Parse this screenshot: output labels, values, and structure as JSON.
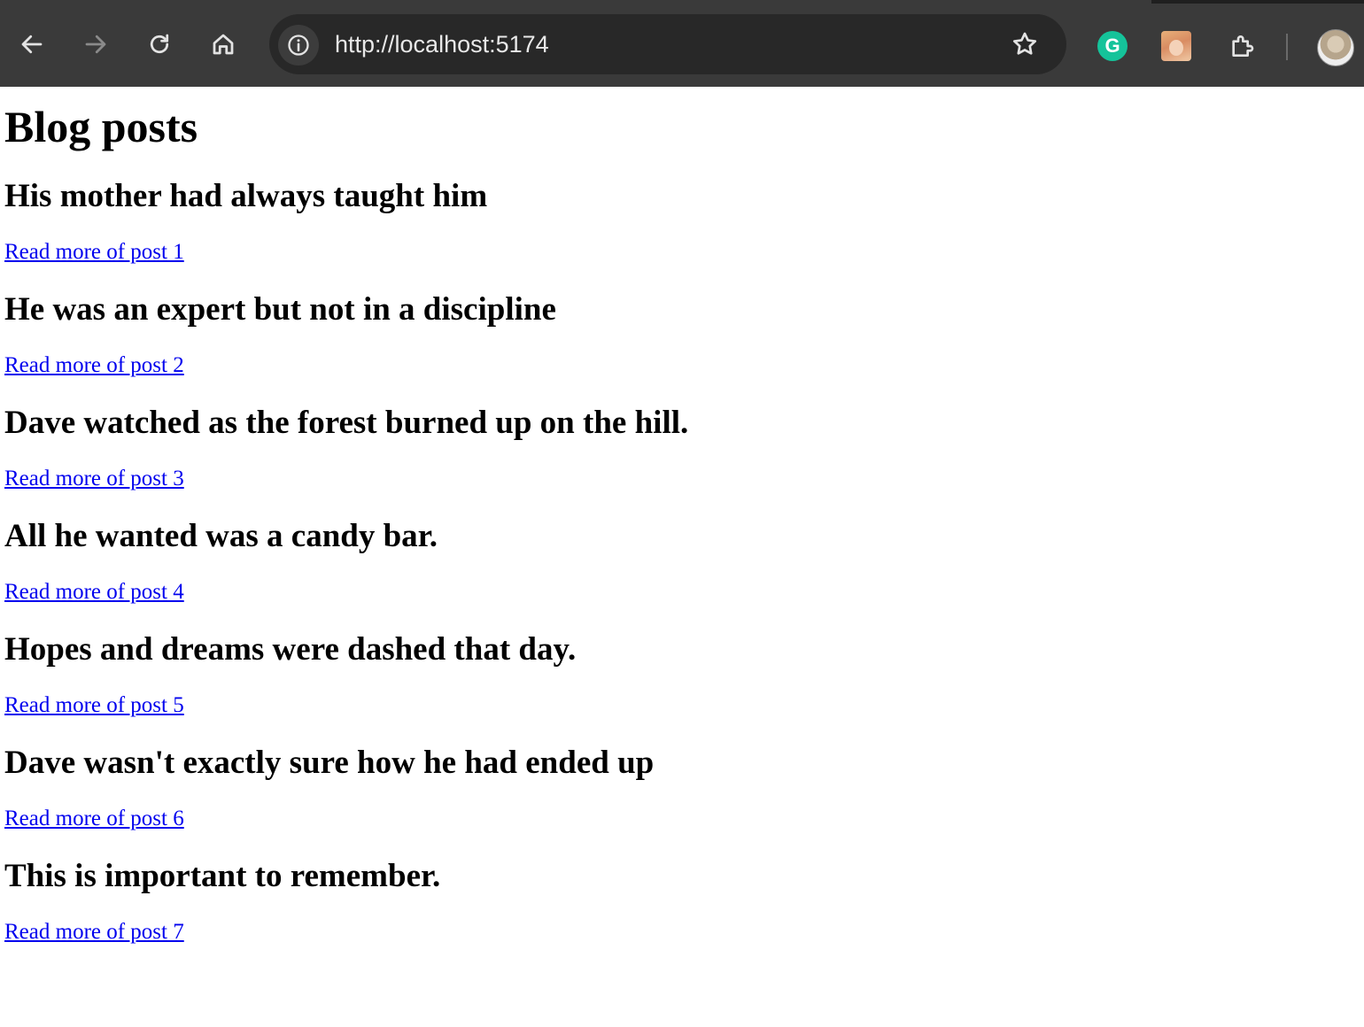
{
  "browser": {
    "url": "http://localhost:5174",
    "icons": {
      "back": "arrow-left-icon",
      "forward": "arrow-right-icon",
      "reload": "reload-icon",
      "home": "home-icon",
      "site_info": "info-icon",
      "bookmark": "star-icon",
      "extensions": "puzzle-icon"
    },
    "extensions": {
      "grammarly_letter": "G"
    }
  },
  "page": {
    "title": "Blog posts",
    "posts": [
      {
        "title": "His mother had always taught him",
        "link": "Read more of post 1"
      },
      {
        "title": "He was an expert but not in a discipline",
        "link": "Read more of post 2"
      },
      {
        "title": "Dave watched as the forest burned up on the hill.",
        "link": "Read more of post 3"
      },
      {
        "title": "All he wanted was a candy bar.",
        "link": "Read more of post 4"
      },
      {
        "title": "Hopes and dreams were dashed that day.",
        "link": "Read more of post 5"
      },
      {
        "title": "Dave wasn't exactly sure how he had ended up",
        "link": "Read more of post 6"
      },
      {
        "title": "This is important to remember.",
        "link": "Read more of post 7"
      }
    ]
  },
  "colors": {
    "toolbar_bg": "#3a3a3a",
    "omnibox_bg": "#282828",
    "link": "#0000ee",
    "text": "#000000"
  }
}
